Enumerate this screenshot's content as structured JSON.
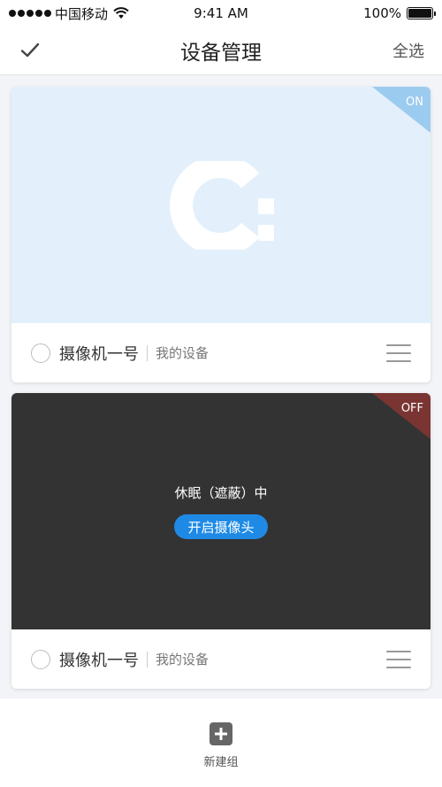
{
  "status_bar": {
    "carrier": "中国移动",
    "time": "9:41 AM",
    "battery": "100%"
  },
  "nav": {
    "title": "设备管理",
    "select_all": "全选",
    "confirm_icon": "checkmark-icon"
  },
  "devices": [
    {
      "status_label": "ON",
      "name": "摄像机一号",
      "group": "我的设备",
      "badge_color": "#9ccbf0",
      "preview_color": "#e3f0fc"
    },
    {
      "status_label": "OFF",
      "name": "摄像机一号",
      "group": "我的设备",
      "badge_color": "#7a3533",
      "preview_color": "#333333",
      "sleep_text": "休眠（遮蔽）中",
      "open_button": "开启摄像头"
    }
  ],
  "bottom": {
    "add_group_label": "新建组",
    "add_icon": "plus-icon"
  },
  "colors": {
    "accent": "#1e8ae6"
  }
}
